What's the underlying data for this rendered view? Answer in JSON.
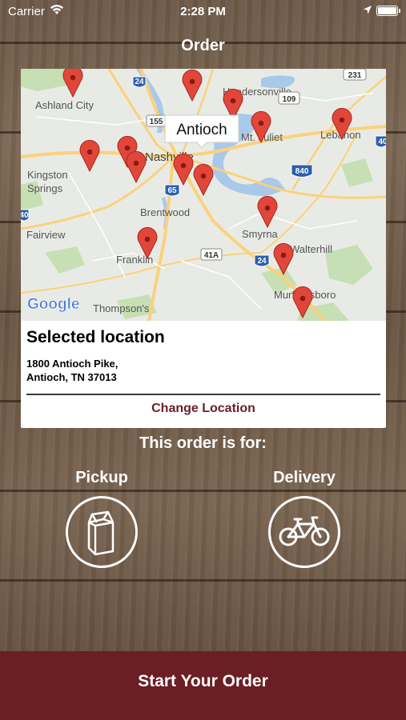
{
  "status_bar": {
    "carrier": "Carrier",
    "time": "2:28 PM",
    "icons": [
      "wifi-icon",
      "location-arrow-icon",
      "battery-icon"
    ]
  },
  "nav": {
    "title": "Order"
  },
  "map": {
    "callout": "Antioch",
    "places": {
      "hendersonville": "Hendersonville",
      "ashland_city": "Ashland City",
      "mt_juliet": "Mt. Juliet",
      "lebanon": "Lebanon",
      "nashville": "Nashville",
      "kingston_springs_1": "Kingston",
      "kingston_springs_2": "Springs",
      "brentwood": "Brentwood",
      "fairview": "Fairview",
      "smyrna": "Smyrna",
      "walterhill": "Walterhill",
      "franklin": "Franklin",
      "murfreesboro": "Murfreesboro",
      "thompsons_station": "Thompson's",
      "google": "Google"
    },
    "shields": {
      "i24_north": "24",
      "r155": "155",
      "r109": "109",
      "r231": "231",
      "i840": "840",
      "i65": "65",
      "r41a": "41A",
      "i24_south": "24",
      "i40_east": "40",
      "i40_west": "40"
    }
  },
  "location": {
    "heading": "Selected location",
    "address_line1": "1800 Antioch Pike,",
    "address_line2": "Antioch, TN 37013",
    "change_label": "Change Location"
  },
  "order": {
    "prompt": "This order is for:",
    "pickup_label": "Pickup",
    "delivery_label": "Delivery"
  },
  "start_button": {
    "label": "Start Your Order"
  },
  "colors": {
    "accent": "#6b1e25",
    "pin": "#e0473a",
    "map_land": "#e8ebe5",
    "map_water": "#a9c9ea",
    "map_park": "#c6dfb5",
    "map_road": "#fcd17a"
  }
}
